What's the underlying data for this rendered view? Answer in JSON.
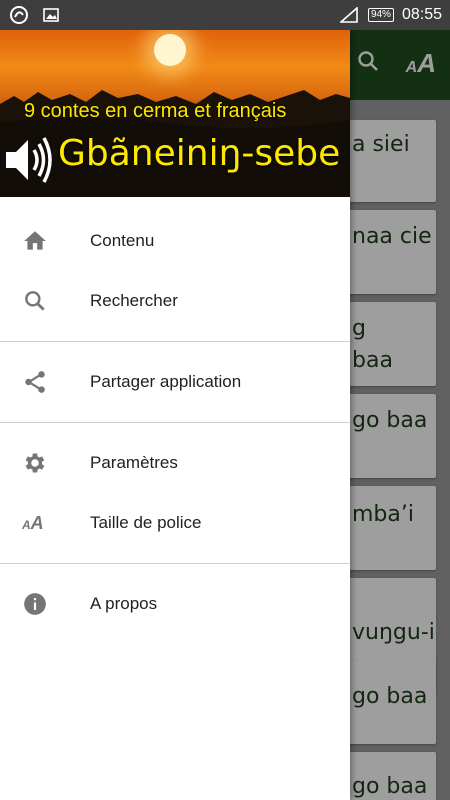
{
  "status_bar": {
    "battery": "94%",
    "time": "08:55"
  },
  "drawer": {
    "header": {
      "subtitle": "9 contes en cerma et français",
      "title": "Gbãneiniŋ-sebe"
    },
    "items": [
      {
        "label": "Contenu",
        "icon": "home-icon"
      },
      {
        "label": "Rechercher",
        "icon": "search-icon"
      },
      {
        "label": "Partager application",
        "icon": "share-icon"
      },
      {
        "label": "Paramètres",
        "icon": "gear-icon"
      },
      {
        "label": "Taille de police",
        "icon": "font-size-icon"
      },
      {
        "label": "A propos",
        "icon": "info-icon"
      }
    ]
  },
  "background_list": {
    "items": [
      "a siei",
      "naa cie",
      "g",
      "baa",
      "go baa",
      "mba’i",
      "vuŋgu-i",
      "go baa",
      "go baa"
    ]
  },
  "colors": {
    "app_bar": "#1f4e1d",
    "title_yellow": "#ffe800",
    "icon_grey": "#757575"
  }
}
